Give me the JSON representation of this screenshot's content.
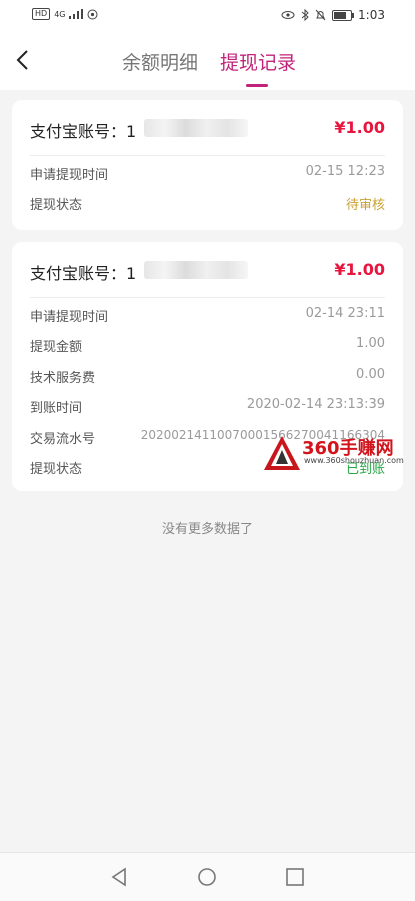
{
  "statusbar": {
    "network_chip": "HD",
    "signal_label": "4G",
    "time": "1:03"
  },
  "header": {
    "tab_balance": "余额明细",
    "tab_withdraw": "提现记录"
  },
  "records": [
    {
      "account_label": "支付宝账号：",
      "account_prefix": "1",
      "amount": "¥1.00",
      "rows": [
        {
          "key": "申请提现时间",
          "value": "02-15 12:23"
        },
        {
          "key": "提现状态",
          "value": "待审核"
        }
      ]
    },
    {
      "account_label": "支付宝账号：",
      "account_prefix": "1",
      "amount": "¥1.00",
      "rows": [
        {
          "key": "申请提现时间",
          "value": "02-14 23:11"
        },
        {
          "key": "提现金额",
          "value": "1.00"
        },
        {
          "key": "技术服务费",
          "value": "0.00"
        },
        {
          "key": "到账时间",
          "value": "2020-02-14 23:13:39"
        },
        {
          "key": "交易流水号",
          "value": "20200214110070001566270041166304"
        },
        {
          "key": "提现状态",
          "value": "已到账"
        }
      ]
    }
  ],
  "footer_text": "没有更多数据了",
  "watermark": {
    "brand": "360手赚网",
    "url": "www.360shouzhuan.com"
  },
  "colors": {
    "accent": "#c2237a",
    "amount": "#e8163e",
    "pending": "#c9a233",
    "arrived": "#27a745"
  }
}
